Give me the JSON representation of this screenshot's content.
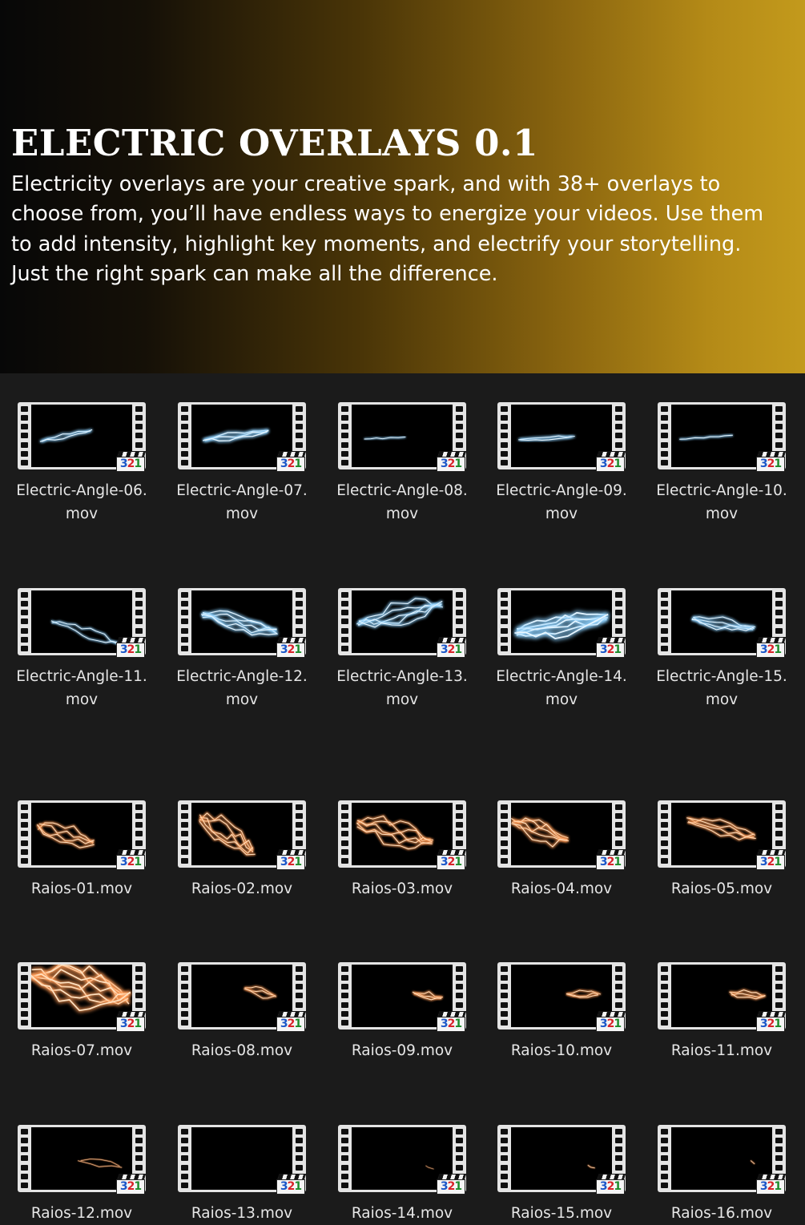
{
  "header": {
    "title": "ELECTRIC OVERLAYS 0.1",
    "description": "Electricity overlays are your creative spark, and with 38+ overlays to choose from, you’ll have endless ways to energize your videos. Use them to add intensity, highlight key moments, and electrify your storytelling. Just the right spark can make all the difference."
  },
  "colors": {
    "gradient_start": "#070707",
    "gradient_end": "#c39a1c",
    "grid_background": "#1b1b1b",
    "blue_spark": "#8fd2ff",
    "orange_spark": "#ff9a55"
  },
  "file_icon": "video-clip-321-icon",
  "badge_text": "321",
  "files": [
    {
      "name": "Electric-Angle-06.mov",
      "line1": "Electric-Angle-06.",
      "line2": "mov",
      "color": "blue",
      "style": 0
    },
    {
      "name": "Electric-Angle-07.mov",
      "line1": "Electric-Angle-07.",
      "line2": "mov",
      "color": "blue",
      "style": 1
    },
    {
      "name": "Electric-Angle-08.mov",
      "line1": "Electric-Angle-08.",
      "line2": "mov",
      "color": "blue",
      "style": 2
    },
    {
      "name": "Electric-Angle-09.mov",
      "line1": "Electric-Angle-09.",
      "line2": "mov",
      "color": "blue",
      "style": 3
    },
    {
      "name": "Electric-Angle-10.mov",
      "line1": "Electric-Angle-10.",
      "line2": "mov",
      "color": "blue",
      "style": 4
    },
    {
      "name": "Electric-Angle-11.mov",
      "line1": "Electric-Angle-11.",
      "line2": "mov",
      "color": "blue",
      "style": 5
    },
    {
      "name": "Electric-Angle-12.mov",
      "line1": "Electric-Angle-12.",
      "line2": "mov",
      "color": "blue",
      "style": 6
    },
    {
      "name": "Electric-Angle-13.mov",
      "line1": "Electric-Angle-13.",
      "line2": "mov",
      "color": "blue",
      "style": 7
    },
    {
      "name": "Electric-Angle-14.mov",
      "line1": "Electric-Angle-14.",
      "line2": "mov",
      "color": "blue",
      "style": 8
    },
    {
      "name": "Electric-Angle-15.mov",
      "line1": "Electric-Angle-15.",
      "line2": "mov",
      "color": "blue",
      "style": 9
    },
    {
      "name": "Raios-01.mov",
      "line1": "Raios-01.mov",
      "line2": "",
      "color": "orange",
      "style": 10
    },
    {
      "name": "Raios-02.mov",
      "line1": "Raios-02.mov",
      "line2": "",
      "color": "orange",
      "style": 11
    },
    {
      "name": "Raios-03.mov",
      "line1": "Raios-03.mov",
      "line2": "",
      "color": "orange",
      "style": 12
    },
    {
      "name": "Raios-04.mov",
      "line1": "Raios-04.mov",
      "line2": "",
      "color": "orange",
      "style": 13
    },
    {
      "name": "Raios-05.mov",
      "line1": "Raios-05.mov",
      "line2": "",
      "color": "orange",
      "style": 14
    },
    {
      "name": "Raios-07.mov",
      "line1": "Raios-07.mov",
      "line2": "",
      "color": "orange",
      "style": 15
    },
    {
      "name": "Raios-08.mov",
      "line1": "Raios-08.mov",
      "line2": "",
      "color": "orange",
      "style": 16
    },
    {
      "name": "Raios-09.mov",
      "line1": "Raios-09.mov",
      "line2": "",
      "color": "orange",
      "style": 17
    },
    {
      "name": "Raios-10.mov",
      "line1": "Raios-10.mov",
      "line2": "",
      "color": "orange",
      "style": 18
    },
    {
      "name": "Raios-11.mov",
      "line1": "Raios-11.mov",
      "line2": "",
      "color": "orange",
      "style": 19
    },
    {
      "name": "Raios-12.mov",
      "line1": "Raios-12.mov",
      "line2": "",
      "color": "orange",
      "style": 20
    },
    {
      "name": "Raios-13.mov",
      "line1": "Raios-13.mov",
      "line2": "",
      "color": "orange",
      "style": 21
    },
    {
      "name": "Raios-14.mov",
      "line1": "Raios-14.mov",
      "line2": "",
      "color": "orange",
      "style": 22
    },
    {
      "name": "Raios-15.mov",
      "line1": "Raios-15.mov",
      "line2": "",
      "color": "orange",
      "style": 23
    },
    {
      "name": "Raios-16.mov",
      "line1": "Raios-16.mov",
      "line2": "",
      "color": "orange",
      "style": 24
    }
  ]
}
